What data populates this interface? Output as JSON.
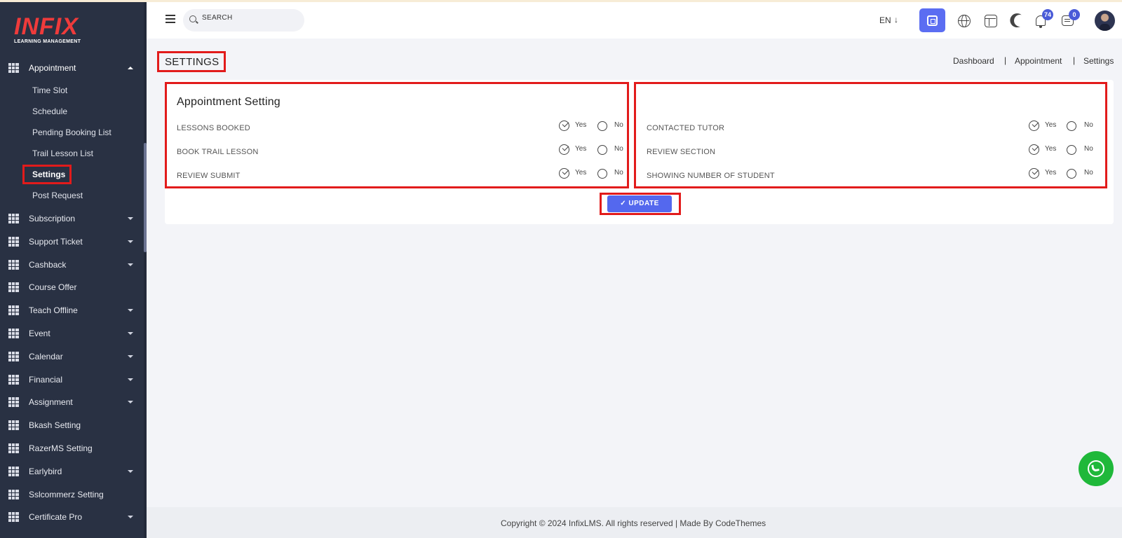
{
  "app": {
    "logo_text": "INFIX",
    "logo_subtitle": "LEARNING MANAGEMENT"
  },
  "sidebar": {
    "section": {
      "label": "Appointment",
      "expanded": true
    },
    "sub_items": [
      {
        "label": "Time Slot"
      },
      {
        "label": "Schedule"
      },
      {
        "label": "Pending Booking List"
      },
      {
        "label": "Trail Lesson List"
      },
      {
        "label": "Settings",
        "selected": true
      },
      {
        "label": "Post Request"
      }
    ],
    "items": [
      {
        "label": "Subscription",
        "has_caret": true
      },
      {
        "label": "Support Ticket",
        "has_caret": true
      },
      {
        "label": "Cashback",
        "has_caret": true
      },
      {
        "label": "Course Offer",
        "has_caret": false
      },
      {
        "label": "Teach Offline",
        "has_caret": true
      },
      {
        "label": "Event",
        "has_caret": true
      },
      {
        "label": "Calendar",
        "has_caret": true
      },
      {
        "label": "Financial",
        "has_caret": true
      },
      {
        "label": "Assignment",
        "has_caret": true
      },
      {
        "label": "Bkash Setting",
        "has_caret": false
      },
      {
        "label": "RazerMS Setting",
        "has_caret": false
      },
      {
        "label": "Earlybird",
        "has_caret": true
      },
      {
        "label": "Sslcommerz Setting",
        "has_caret": false
      },
      {
        "label": "Certificate Pro",
        "has_caret": true
      }
    ]
  },
  "header": {
    "search_placeholder": "SEARCH",
    "language": "EN",
    "language_arrow": "↓",
    "notification_count": "74",
    "message_count": "0",
    "accent_color": "#5b6df2"
  },
  "page": {
    "title": "SETTINGS",
    "breadcrumb": [
      "Dashboard",
      "Appointment",
      "Settings"
    ],
    "breadcrumb_sep": "|"
  },
  "settings": {
    "card_title": "Appointment Setting",
    "yes_label": "Yes",
    "no_label": "No",
    "left": [
      {
        "label": "LESSONS BOOKED",
        "value": "Yes"
      },
      {
        "label": "BOOK TRAIL LESSON",
        "value": "Yes"
      },
      {
        "label": "REVIEW SUBMIT",
        "value": "Yes"
      }
    ],
    "right": [
      {
        "label": "CONTACTED TUTOR",
        "value": "Yes"
      },
      {
        "label": "REVIEW SECTION",
        "value": "Yes"
      },
      {
        "label": "SHOWING NUMBER OF STUDENT",
        "value": "Yes"
      }
    ],
    "update_label": "✓ UPDATE"
  },
  "footer": {
    "text": "Copyright © 2024 InfixLMS. All rights reserved | Made By CodeThemes"
  },
  "colors": {
    "sidebar_bg": "#293143",
    "highlight": "#e21b1b",
    "primary": "#5468ee",
    "whatsapp": "#1fb83a"
  }
}
